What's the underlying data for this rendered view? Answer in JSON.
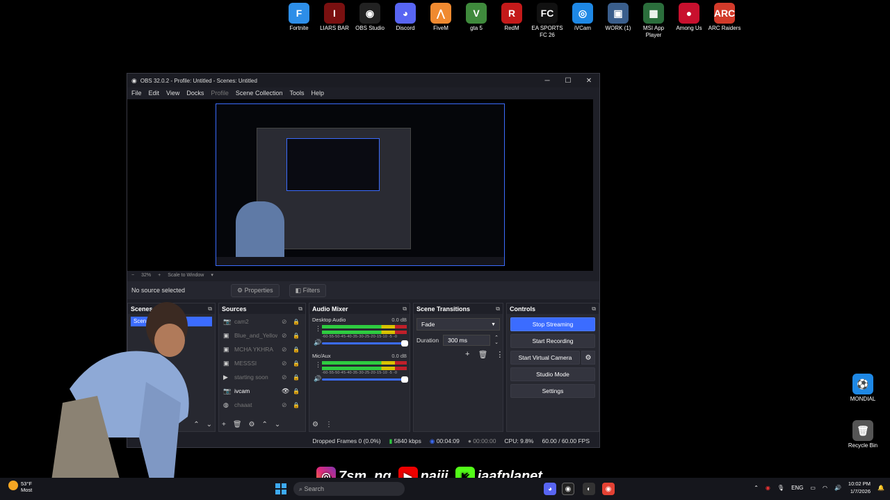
{
  "desktop": {
    "icons": [
      {
        "label": "Fortnite",
        "glyph": "F",
        "color": "#2d8ee8"
      },
      {
        "label": "LIARS BAR",
        "glyph": "I",
        "color": "#7a1010"
      },
      {
        "label": "OBS Studio",
        "glyph": "◉",
        "color": "#222"
      },
      {
        "label": "Discord",
        "glyph": "◕",
        "color": "#5865f2"
      },
      {
        "label": "FiveM",
        "glyph": "⋀",
        "color": "#f08a30"
      },
      {
        "label": "gta 5",
        "glyph": "V",
        "color": "#3f8a3c"
      },
      {
        "label": "RedM",
        "glyph": "R",
        "color": "#c41a1a"
      },
      {
        "label": "EA SPORTS FC 26",
        "glyph": "FC",
        "color": "#111"
      },
      {
        "label": "iVCam",
        "glyph": "◎",
        "color": "#1e88e5"
      },
      {
        "label": "WORK (1)",
        "glyph": "▣",
        "color": "#3a5e8c"
      },
      {
        "label": "MSI App Player",
        "glyph": "▦",
        "color": "#2b6e3c"
      },
      {
        "label": "Among Us",
        "glyph": "●",
        "color": "#c8102e"
      },
      {
        "label": "ARC Raiders",
        "glyph": "ARC",
        "color": "#d23a2a"
      }
    ],
    "right_icons": [
      {
        "label": "MONDIAL",
        "glyph": "⚽",
        "color": "#1e88e5"
      },
      {
        "label": "Recycle Bin",
        "glyph": "🗑",
        "color": "#555"
      }
    ]
  },
  "obs": {
    "title": "OBS 32.0.2 - Profile: Untitled - Scenes: Untitled",
    "menu": [
      "File",
      "Edit",
      "View",
      "Docks",
      "Profile",
      "Scene Collection",
      "Tools",
      "Help"
    ],
    "zoom": {
      "minus": "−",
      "level": "32%",
      "plus": "+",
      "mode": "Scale to Window"
    },
    "source_bar": {
      "status": "No source selected",
      "properties": "Properties",
      "filters": "Filters"
    },
    "scenes": {
      "title": "Scenes",
      "items": [
        "Scene"
      ]
    },
    "sources": {
      "title": "Sources",
      "items": [
        {
          "icon": "📷",
          "name": "cam2",
          "visible": false
        },
        {
          "icon": "▣",
          "name": "Blue_and_Yellow",
          "visible": false
        },
        {
          "icon": "▣",
          "name": "MCHA YKHRA",
          "visible": false
        },
        {
          "icon": "▣",
          "name": "MESSSI",
          "visible": false
        },
        {
          "icon": "▶",
          "name": "starting soon",
          "visible": false
        },
        {
          "icon": "📷",
          "name": "ivcam",
          "visible": true
        },
        {
          "icon": "◍",
          "name": "chaaat",
          "visible": false
        }
      ]
    },
    "mixer": {
      "title": "Audio Mixer",
      "channels": [
        {
          "name": "Desktop Audio",
          "db": "0.0 dB",
          "scale": "-60-55-50-45-40-35-30-25-20-15-10 -5 -0"
        },
        {
          "name": "Mic/Aux",
          "db": "0.0 dB",
          "scale": "-60-55-50-45-40-35-30-25-20-15-10 -5 -0"
        }
      ]
    },
    "transitions": {
      "title": "Scene Transitions",
      "type": "Fade",
      "duration_label": "Duration",
      "duration": "300 ms"
    },
    "controls": {
      "title": "Controls",
      "stop_streaming": "Stop Streaming",
      "start_recording": "Start Recording",
      "start_virtual_camera": "Start Virtual Camera",
      "studio_mode": "Studio Mode",
      "settings": "Settings"
    },
    "status": {
      "dropped": "Dropped Frames 0 (0.0%)",
      "bitrate": "5840 kbps",
      "stream_time": "00:04:09",
      "rec_time": "00:00:00",
      "cpu": "CPU: 9.8%",
      "fps": "60.00 / 60.00 FPS"
    }
  },
  "overlay": {
    "instagram": "7sm_ng",
    "youtube": "najjj",
    "kick": "jaafplanet"
  },
  "taskbar": {
    "weather_temp": "53°F",
    "weather_text": "Most",
    "search": "Search",
    "lang": "ENG",
    "time": "10:02 PM",
    "date": "1/7/2026"
  }
}
